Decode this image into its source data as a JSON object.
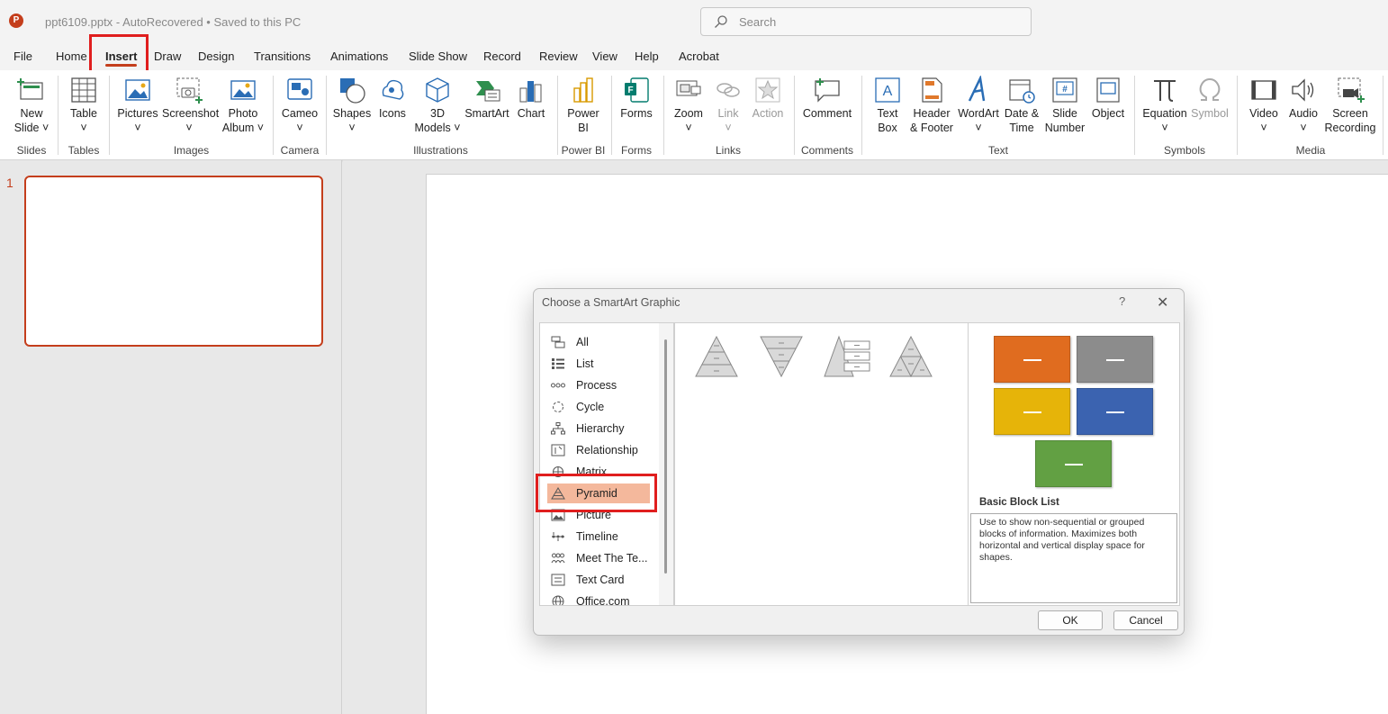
{
  "titlebar": {
    "file_name": "ppt6109.pptx",
    "separator": "-",
    "status": "AutoRecovered • Saved to this PC",
    "search_placeholder": "Search"
  },
  "menu_tabs": [
    "File",
    "Home",
    "Insert",
    "Draw",
    "Design",
    "Transitions",
    "Animations",
    "Slide Show",
    "Record",
    "Review",
    "View",
    "Help",
    "Acrobat"
  ],
  "active_tab": "Insert",
  "ribbon": {
    "groups": {
      "slides": "Slides",
      "tables": "Tables",
      "images": "Images",
      "camera": "Camera",
      "illustrations": "Illustrations",
      "powerbi": "Power BI",
      "forms": "Forms",
      "links": "Links",
      "comments": "Comments",
      "text": "Text",
      "symbols": "Symbols",
      "media": "Media"
    },
    "buttons": {
      "new_slide": [
        "New",
        "Slide ˅"
      ],
      "table": [
        "Table",
        "˅"
      ],
      "pictures": [
        "Pictures",
        "˅"
      ],
      "screenshot": [
        "Screenshot",
        "˅"
      ],
      "photo_album": [
        "Photo",
        "Album ˅"
      ],
      "cameo": [
        "Cameo",
        "˅"
      ],
      "shapes": [
        "Shapes",
        "˅"
      ],
      "icons": [
        "Icons"
      ],
      "models_3d": [
        "3D",
        "Models ˅"
      ],
      "smartart": [
        "SmartArt"
      ],
      "chart": [
        "Chart"
      ],
      "power_bi": [
        "Power",
        "BI"
      ],
      "forms": [
        "Forms"
      ],
      "zoom": [
        "Zoom",
        "˅"
      ],
      "link": [
        "Link",
        "˅"
      ],
      "action": [
        "Action"
      ],
      "comment": [
        "Comment"
      ],
      "text_box": [
        "Text",
        "Box"
      ],
      "header_footer": [
        "Header",
        "& Footer"
      ],
      "wordart": [
        "WordArt",
        "˅"
      ],
      "date_time": [
        "Date &",
        "Time"
      ],
      "slide_number": [
        "Slide",
        "Number"
      ],
      "object": [
        "Object"
      ],
      "equation": [
        "Equation",
        "˅"
      ],
      "symbol": [
        "Symbol"
      ],
      "video": [
        "Video",
        "˅"
      ],
      "audio": [
        "Audio",
        "˅"
      ],
      "screen_recording": [
        "Screen",
        "Recording"
      ]
    }
  },
  "thumbnails": {
    "slide_number": "1"
  },
  "dialog": {
    "title": "Choose a SmartArt Graphic",
    "help": "?",
    "close": "✕",
    "categories": [
      "All",
      "List",
      "Process",
      "Cycle",
      "Hierarchy",
      "Relationship",
      "Matrix",
      "Pyramid",
      "Picture",
      "Timeline",
      "Meet The Te...",
      "Text Card",
      "Office.com"
    ],
    "selected_category": "Pyramid",
    "preview": {
      "name": "Basic Block List",
      "description": "Use to show non-sequential or grouped blocks of information. Maximizes both horizontal and vertical display space for shapes.",
      "block_colors": [
        "#e06c1f",
        "#8c8c8c",
        "#e6b409",
        "#3b63b0",
        "#62a043"
      ]
    },
    "ok": "OK",
    "cancel": "Cancel"
  },
  "colors": {
    "accent": "#c43e1c",
    "highlight_box": "#e01e1e",
    "selected_bg": "#f4b89c"
  }
}
